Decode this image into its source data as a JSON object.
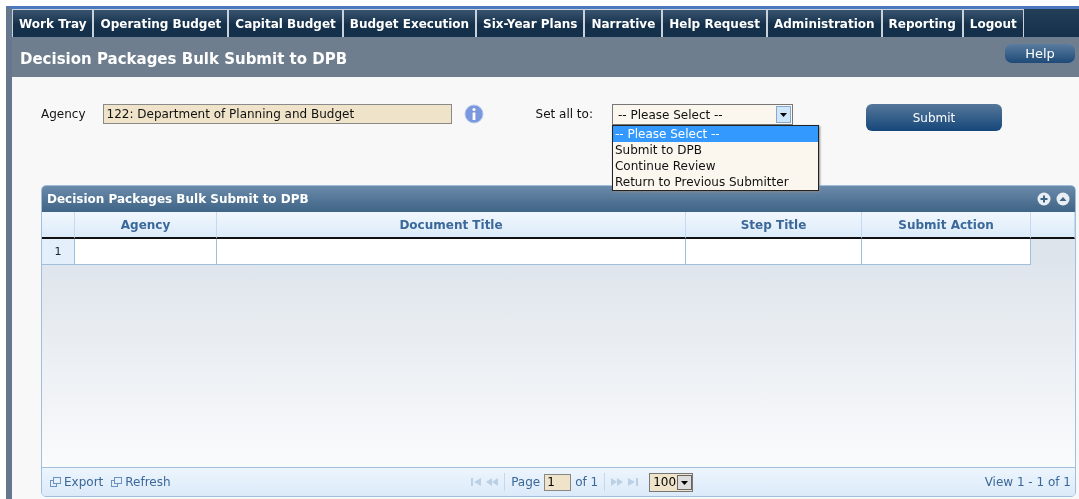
{
  "nav": {
    "items": [
      {
        "label": "Work Tray"
      },
      {
        "label": "Operating Budget"
      },
      {
        "label": "Capital Budget"
      },
      {
        "label": "Budget Execution"
      },
      {
        "label": "Six-Year Plans"
      },
      {
        "label": "Narrative"
      },
      {
        "label": "Help Request"
      },
      {
        "label": "Administration"
      },
      {
        "label": "Reporting"
      },
      {
        "label": "Logout"
      }
    ]
  },
  "header": {
    "title": "Decision Packages Bulk Submit to DPB",
    "help_button": "Help"
  },
  "form": {
    "agency_label": "Agency",
    "agency_value": "122: Department of Planning and Budget",
    "set_all_label": "Set all to:",
    "set_all_value": "-- Please Select --",
    "dropdown": {
      "expanded": true,
      "options": [
        {
          "label": "-- Please Select --",
          "selected": true
        },
        {
          "label": "Submit to DPB",
          "selected": false
        },
        {
          "label": "Continue Review",
          "selected": false
        },
        {
          "label": "Return to Previous Submitter",
          "selected": false
        }
      ]
    },
    "submit_button": "Submit"
  },
  "grid": {
    "title": "Decision Packages Bulk Submit to DPB",
    "columns": [
      "Agency",
      "Document Title",
      "Step Title",
      "Submit Action"
    ],
    "rows": [
      {
        "number": "1"
      }
    ]
  },
  "footer": {
    "actions": [
      "Export",
      "Refresh"
    ],
    "page_label": "Page",
    "page_value": "1",
    "page_total": "of 1",
    "page_size": "100",
    "view_info": "View 1 - 1 of 1"
  }
}
